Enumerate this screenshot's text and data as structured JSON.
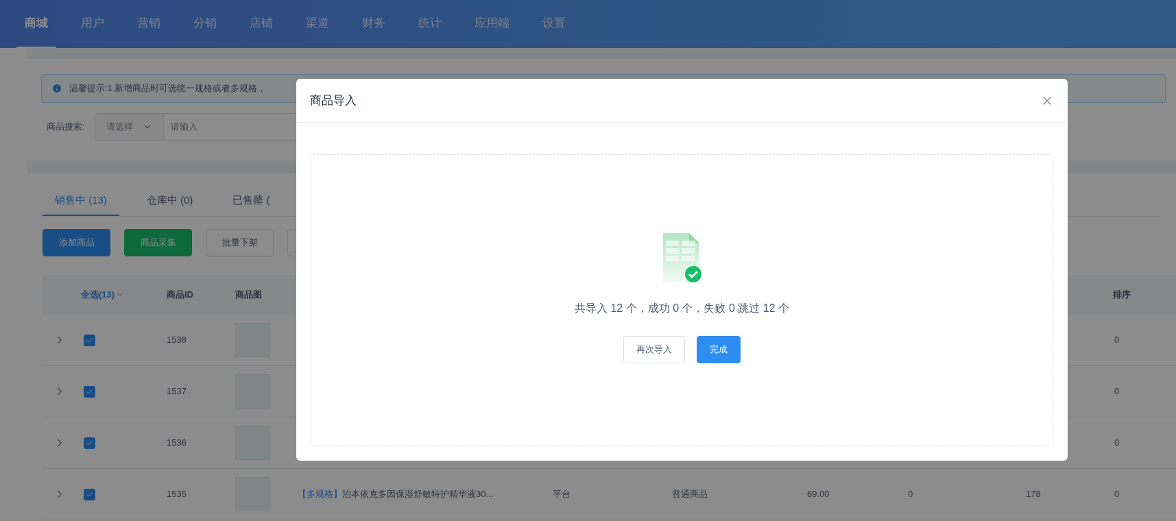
{
  "nav": [
    {
      "label": "商城",
      "selected": true
    },
    {
      "label": "用户",
      "selected": false
    },
    {
      "label": "营销",
      "selected": false
    },
    {
      "label": "分销",
      "selected": false
    },
    {
      "label": "店铺",
      "selected": false
    },
    {
      "label": "渠道",
      "selected": false
    },
    {
      "label": "财务",
      "selected": false
    },
    {
      "label": "统计",
      "selected": false
    },
    {
      "label": "应用端",
      "selected": false
    },
    {
      "label": "设置",
      "selected": false
    }
  ],
  "notice": {
    "text": "温馨提示:1.新增商品时可选统一规格或者多规格，"
  },
  "search": {
    "label": "商品搜索:",
    "select_placeholder": "请选择",
    "input_placeholder": "请输入"
  },
  "tabs": [
    {
      "label": "销售中 (13)",
      "selected": true
    },
    {
      "label": "仓库中 (0)",
      "selected": false
    },
    {
      "label": "已售罄 (",
      "selected": false
    }
  ],
  "actions": [
    {
      "label": "添加商品",
      "kind": "primary"
    },
    {
      "label": "商品采集",
      "kind": "success"
    },
    {
      "label": "批量下架",
      "kind": "default"
    }
  ],
  "table": {
    "select_all": "全选(13)",
    "columns": {
      "id": "商品ID",
      "image": "商品图",
      "sort": "排序"
    },
    "rows": [
      {
        "checked": true,
        "id": "1538",
        "sort": "0"
      },
      {
        "checked": true,
        "id": "1537",
        "sort": "0"
      },
      {
        "checked": true,
        "id": "1536",
        "sort": "0"
      },
      {
        "checked": true,
        "id": "1535",
        "name_tag": "【多规格】",
        "name": "泊本依克多因保湿舒敏特护精华液30...",
        "column_6": "平台",
        "column_7": "普通商品",
        "column_8": "69.00",
        "column_9": "0",
        "column_10": "178",
        "sort": "0"
      }
    ]
  },
  "modal": {
    "title": "商品导入",
    "summary": "共导入 12 个，成功 0 个，失败 0 跳过 12 个",
    "buttons": [
      {
        "label": "再次导入",
        "kind": "default"
      },
      {
        "label": "完成",
        "kind": "primary"
      }
    ]
  }
}
